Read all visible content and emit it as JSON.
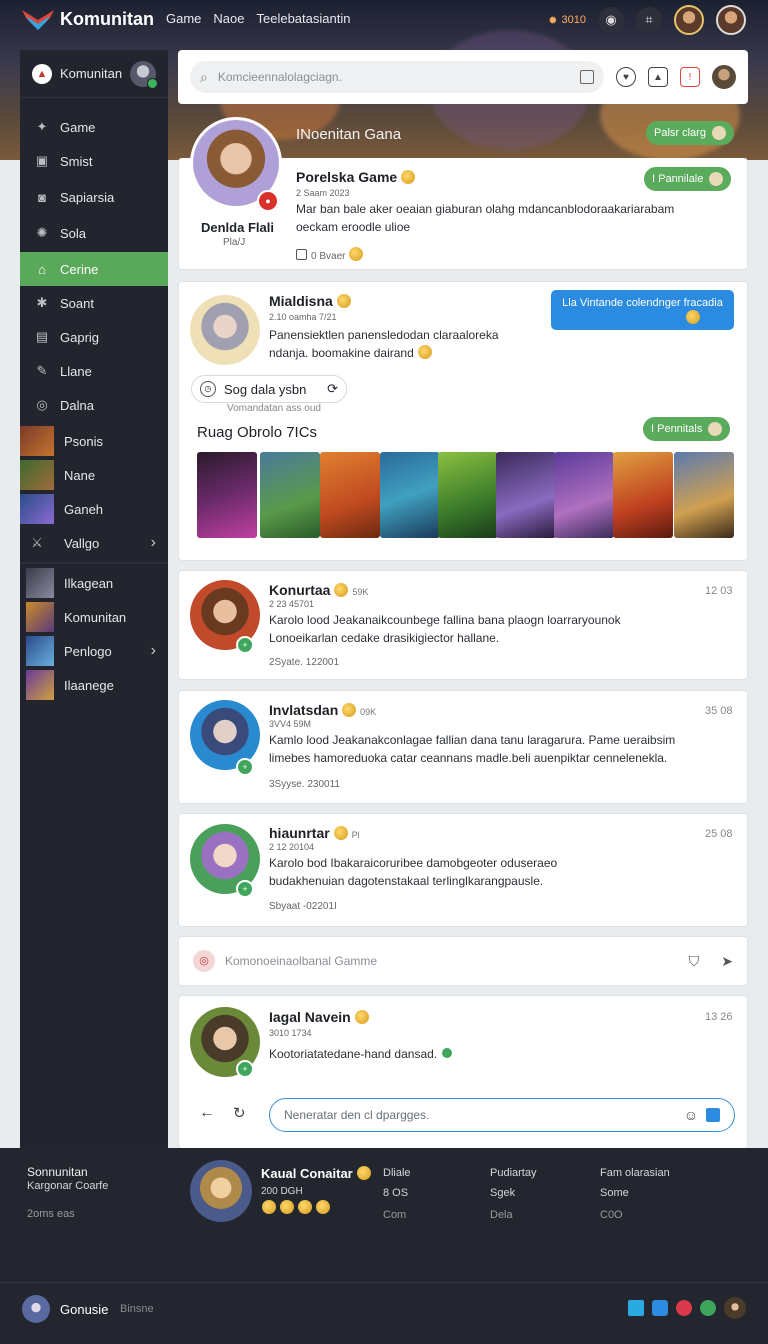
{
  "topbar": {
    "brand": "Komunitan",
    "nav": [
      "Game",
      "Naoe",
      "Teelebatasiantin"
    ],
    "stat": "3010",
    "colors": {
      "accent_green": "#5aab5c",
      "accent_blue": "#2b8be0",
      "sidebar_bg": "#22252d"
    }
  },
  "sidebar": {
    "title": "Komunitan",
    "items": [
      {
        "label": "Game",
        "icon": "gamepad-icon"
      },
      {
        "label": "Smist",
        "icon": "doc-icon"
      },
      {
        "label": "Sapiarsia",
        "icon": "briefcase-icon"
      },
      {
        "label": "Sola",
        "icon": "gear-icon"
      },
      {
        "label": "Cerine",
        "icon": "home-icon",
        "active": true
      },
      {
        "label": "Soant",
        "icon": "cog-icon"
      },
      {
        "label": "Gaprig",
        "icon": "clipboard-icon"
      },
      {
        "label": "Llane",
        "icon": "pencil-icon"
      },
      {
        "label": "Dalna",
        "icon": "coin-icon"
      }
    ],
    "thumbs": [
      {
        "label": "Psonis"
      },
      {
        "label": "Nane"
      },
      {
        "label": "Ganeh"
      },
      {
        "label": "Vallgo",
        "chevron": true
      },
      {
        "label": "Ilkagean"
      },
      {
        "label": "Komunitan"
      },
      {
        "label": "Penlogo",
        "chevron": true
      },
      {
        "label": "Ilaanege"
      }
    ]
  },
  "search": {
    "placeholder": "Komcieennalolagciagn."
  },
  "banner": {
    "title": "INoenitan Gana",
    "pill": "Palsr clarg"
  },
  "profile": {
    "name": "Denlda Flali",
    "sub": "Pla/J",
    "post_title": "Porelska Game",
    "meta": "2 Saam 2023",
    "body": "Mar ban bale aker oeaian giaburan olahg mdancanblodoraakariarabam oeckam eroodle ulioe",
    "foot": "0 Bvaer",
    "pill": "I Pannilale"
  },
  "post1": {
    "name": "Mialdisna",
    "meta": "2.10 oamha 7/21",
    "body": "Panensiektlen panensledodan claraaloreka ndanja. boomakine dairand",
    "blue_btn": "Lla Vintande colendnger fracadia",
    "comment_label": "Sog dala ysbn",
    "comment_sub": "Vomandatan ass oud",
    "gallery_title": "Ruag Obrolo 7ICs",
    "gallery_pill": "I Pennitals"
  },
  "posts": [
    {
      "name": "Konurtaa",
      "tag": "59K",
      "meta": "2 23 45701",
      "body": "Karolo lood Jeakanaikcounbege fallina bana plaogn loarraryounok Lonoeikarlan cedake drasikigiector hallane.",
      "foot": "2Syate. 122001",
      "time": "12 03"
    },
    {
      "name": "Invlatsdan",
      "tag": "09K",
      "meta": "3VV4 59M",
      "body": "Kamlo lood Jeakanakconlagae fallian dana tanu laragarura. Pame ueraibsim limebes hamoreduoka catar ceannans madle.beli auenpiktar cennelenekla.",
      "foot": "3Syyse. 230011",
      "time": "35 08"
    },
    {
      "name": "hiaunrtar",
      "tag": "Pl",
      "meta": "2 12 20104",
      "body": "Karolo bod Ibakaraicoruribee damobgeoter oduseraeo budakhenuian dagotenstakaal terlinglkarangpausle.",
      "foot": "Sbyaat -02201I",
      "time": "25 08"
    }
  ],
  "community_bar": {
    "placeholder": "Komonoeinaolbanal Gamme"
  },
  "last_post": {
    "name": "Iagal Navein",
    "meta": "3010 1734",
    "body": "Kootoriatatedane-hand dansad.",
    "time": "13 26"
  },
  "reply": {
    "placeholder": "Neneratar den cl dpargges."
  },
  "footer": {
    "left_title": "Sonnunitan",
    "left_sub": "Kargonar Coarfe",
    "left_small": "2oms  eas",
    "profile_name": "Kaual Conaitar",
    "profile_meta": "200 DGH",
    "col1": [
      "Dliale",
      "8 OS",
      "Com"
    ],
    "col2": [
      "Pudiartay",
      "Sgek",
      "Dela"
    ],
    "col3": [
      "Fam olarasian",
      "Some",
      "C0O"
    ],
    "bottom_name": "Gonusie",
    "bottom_sub": "Binsne"
  }
}
